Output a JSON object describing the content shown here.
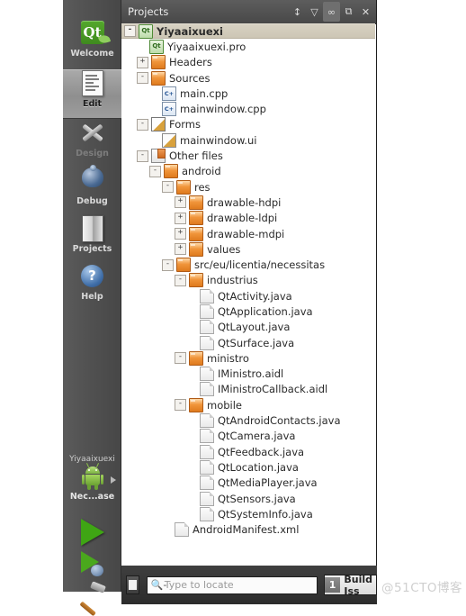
{
  "modebar": {
    "items": [
      {
        "label": "Welcome",
        "icon": "qt-logo-icon",
        "selected": false
      },
      {
        "label": "Edit",
        "icon": "document-edit-icon",
        "selected": true
      },
      {
        "label": "Design",
        "icon": "design-tools-icon",
        "selected": false,
        "dim": true
      },
      {
        "label": "Debug",
        "icon": "debug-bug-icon",
        "selected": false
      },
      {
        "label": "Projects",
        "icon": "projects-book-icon",
        "selected": false
      },
      {
        "label": "Help",
        "icon": "help-question-icon",
        "selected": false
      }
    ],
    "kit": {
      "project_name": "Yiyaaixuexi",
      "target_label": "Nec...ase",
      "android_icon": "android-robot-icon",
      "arrow_icon": "kit-selector-arrow-icon"
    },
    "actions": [
      {
        "name": "run-button",
        "icon": "play-triangle-icon"
      },
      {
        "name": "debug-button",
        "icon": "play-with-bug-icon"
      },
      {
        "name": "build-button",
        "icon": "hammer-icon"
      }
    ]
  },
  "pane": {
    "title": "Projects",
    "buttons": [
      {
        "name": "view-selector",
        "icon": "chevron-updown-icon",
        "glyph": "↕"
      },
      {
        "name": "filter-button",
        "icon": "filter-funnel-icon",
        "glyph": "▽"
      },
      {
        "name": "sync-button",
        "icon": "link-sync-icon",
        "glyph": "∞",
        "active": true
      },
      {
        "name": "split-button",
        "icon": "split-pane-icon",
        "glyph": "⧉"
      },
      {
        "name": "close-button",
        "icon": "close-x-icon",
        "glyph": "✕"
      }
    ]
  },
  "tree": [
    {
      "label": "Yiyaaixuexi",
      "depth": 0,
      "exp": "-",
      "icon": "pro",
      "iconText": "Qt",
      "selected": true
    },
    {
      "label": "Yiyaaixuexi.pro",
      "depth": 1,
      "exp": "",
      "icon": "pro",
      "iconText": "Qt"
    },
    {
      "label": "Headers",
      "depth": 1,
      "exp": "+",
      "icon": "folder hdr"
    },
    {
      "label": "Sources",
      "depth": 1,
      "exp": "-",
      "icon": "folder src"
    },
    {
      "label": "main.cpp",
      "depth": 2,
      "exp": "",
      "icon": "cpp",
      "iconText": "C+"
    },
    {
      "label": "mainwindow.cpp",
      "depth": 2,
      "exp": "",
      "icon": "cpp",
      "iconText": "C+"
    },
    {
      "label": "Forms",
      "depth": 1,
      "exp": "-",
      "icon": "forms"
    },
    {
      "label": "mainwindow.ui",
      "depth": 2,
      "exp": "",
      "icon": "ui"
    },
    {
      "label": "Other files",
      "depth": 1,
      "exp": "-",
      "icon": "other"
    },
    {
      "label": "android",
      "depth": 2,
      "exp": "-",
      "icon": "folder"
    },
    {
      "label": "res",
      "depth": 3,
      "exp": "-",
      "icon": "folder"
    },
    {
      "label": "drawable-hdpi",
      "depth": 4,
      "exp": "+",
      "icon": "folder"
    },
    {
      "label": "drawable-ldpi",
      "depth": 4,
      "exp": "+",
      "icon": "folder"
    },
    {
      "label": "drawable-mdpi",
      "depth": 4,
      "exp": "+",
      "icon": "folder"
    },
    {
      "label": "values",
      "depth": 4,
      "exp": "+",
      "icon": "folder"
    },
    {
      "label": "src/eu/licentia/necessitas",
      "depth": 3,
      "exp": "-",
      "icon": "folder"
    },
    {
      "label": "industrius",
      "depth": 4,
      "exp": "-",
      "icon": "folder"
    },
    {
      "label": "QtActivity.java",
      "depth": 5,
      "exp": "",
      "icon": "file"
    },
    {
      "label": "QtApplication.java",
      "depth": 5,
      "exp": "",
      "icon": "file"
    },
    {
      "label": "QtLayout.java",
      "depth": 5,
      "exp": "",
      "icon": "file"
    },
    {
      "label": "QtSurface.java",
      "depth": 5,
      "exp": "",
      "icon": "file"
    },
    {
      "label": "ministro",
      "depth": 4,
      "exp": "-",
      "icon": "folder"
    },
    {
      "label": "IMinistro.aidl",
      "depth": 5,
      "exp": "",
      "icon": "file"
    },
    {
      "label": "IMinistroCallback.aidl",
      "depth": 5,
      "exp": "",
      "icon": "file"
    },
    {
      "label": "mobile",
      "depth": 4,
      "exp": "-",
      "icon": "folder"
    },
    {
      "label": "QtAndroidContacts.java",
      "depth": 5,
      "exp": "",
      "icon": "file"
    },
    {
      "label": "QtCamera.java",
      "depth": 5,
      "exp": "",
      "icon": "file"
    },
    {
      "label": "QtFeedback.java",
      "depth": 5,
      "exp": "",
      "icon": "file"
    },
    {
      "label": "QtLocation.java",
      "depth": 5,
      "exp": "",
      "icon": "file"
    },
    {
      "label": "QtMediaPlayer.java",
      "depth": 5,
      "exp": "",
      "icon": "file"
    },
    {
      "label": "QtSensors.java",
      "depth": 5,
      "exp": "",
      "icon": "file"
    },
    {
      "label": "QtSystemInfo.java",
      "depth": 5,
      "exp": "",
      "icon": "file"
    },
    {
      "label": "AndroidManifest.xml",
      "depth": 3,
      "exp": "",
      "icon": "file"
    }
  ],
  "bottombar": {
    "output_pane_icon": "output-pane-toggle-icon",
    "locator_placeholder": "Type to locate",
    "search_icon": "magnifier-icon",
    "issues_count": "1",
    "issues_label": "Build Iss"
  },
  "watermark": "@51CTO博客"
}
